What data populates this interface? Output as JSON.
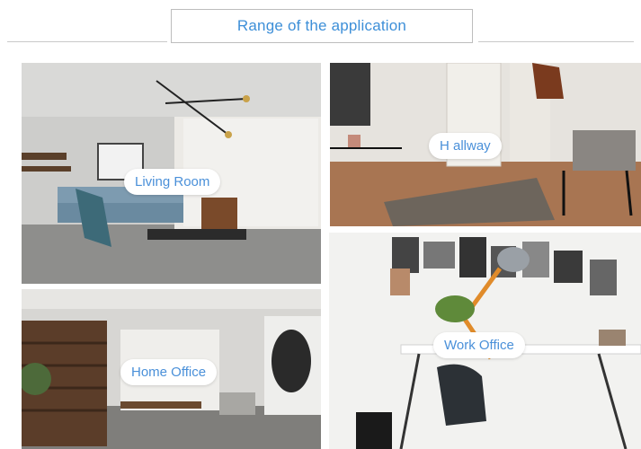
{
  "header": {
    "title": "Range of the application"
  },
  "rooms": [
    {
      "label": "Living Room"
    },
    {
      "label": "H allway"
    },
    {
      "label": "Home Office"
    },
    {
      "label": "Work Office"
    }
  ]
}
